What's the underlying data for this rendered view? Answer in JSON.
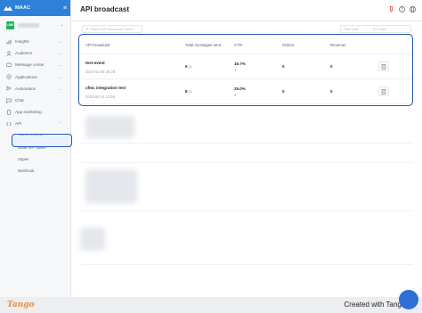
{
  "colors": {
    "brand": "#2f80d8",
    "highlight": "#1f57b3",
    "active_bg": "#e8f1fc",
    "tango": "#e88f3c"
  },
  "app": {
    "name": "MAAC",
    "menu_icon": "hamburger-icon",
    "account_badge": "LINE"
  },
  "sidebar": {
    "items": [
      {
        "label": "Insights",
        "icon": "bar-chart-icon",
        "expandable": true
      },
      {
        "label": "Audience",
        "icon": "people-icon",
        "expandable": true
      },
      {
        "label": "Message center",
        "icon": "message-icon",
        "expandable": true
      },
      {
        "label": "Applications",
        "icon": "apps-icon",
        "expandable": true
      },
      {
        "label": "Automation",
        "icon": "automation-icon",
        "expandable": true
      },
      {
        "label": "Chat",
        "icon": "chat-icon",
        "expandable": false
      },
      {
        "label": "App marketing",
        "icon": "mobile-icon",
        "expandable": false
      },
      {
        "label": "API",
        "icon": "api-icon",
        "expandable": true
      }
    ],
    "api_sub": [
      {
        "label": "API broadcast",
        "active": true
      },
      {
        "label": "Issue API Token",
        "active": false
      },
      {
        "label": "Zapier",
        "active": false
      },
      {
        "label": "Webhook",
        "active": false
      }
    ]
  },
  "header": {
    "title": "API broadcast"
  },
  "toolbar": {
    "search_placeholder": "Search API broadcast name",
    "start_date_placeholder": "Start date",
    "end_date_placeholder": "End date",
    "date_separator": "→"
  },
  "table": {
    "columns": [
      "API broadcast",
      "Total messages sent",
      "CTR",
      "Orders",
      "Revenue"
    ],
    "rows": [
      {
        "name": "test-event",
        "date": "2024-01-05 20:28",
        "sent": "6",
        "ctr": "16.7%",
        "ctr_count": "1",
        "orders": "0",
        "revenue": "0"
      },
      {
        "name": "cfmc integration test",
        "date": "2023-06-14 13:56",
        "sent": "8",
        "ctr": "25.0%",
        "ctr_count": "2",
        "orders": "0",
        "revenue": "0"
      }
    ]
  },
  "footer": {
    "logo": "Tango",
    "created": "Created with Tango.us"
  }
}
